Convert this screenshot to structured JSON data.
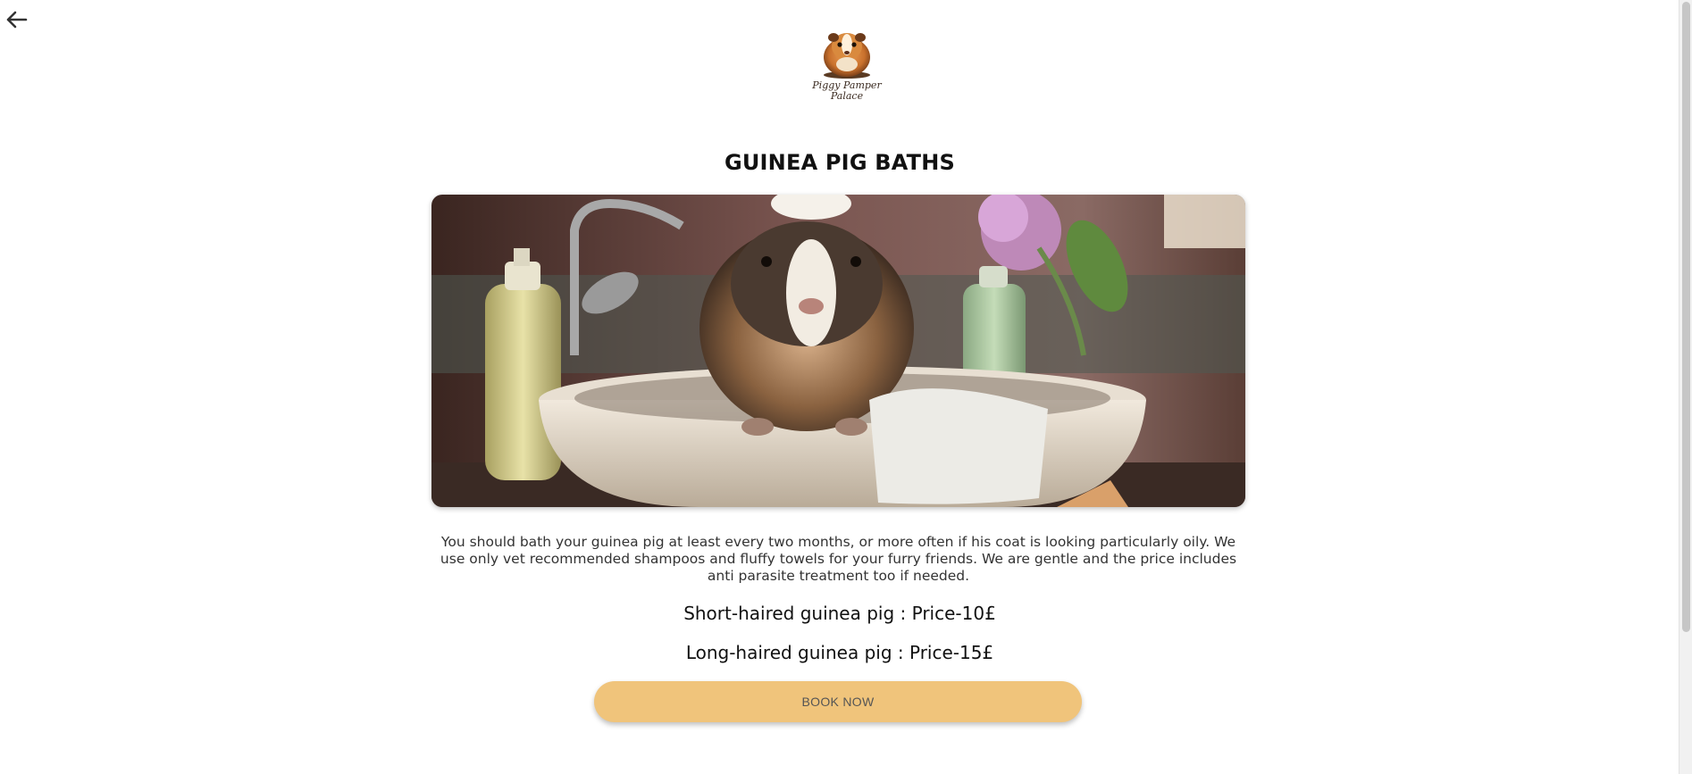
{
  "header": {
    "back_icon": "arrow-left-icon",
    "logo": {
      "name_line1": "Piggy Pamper",
      "name_line2": "Palace"
    }
  },
  "main": {
    "title": "GUINEA PIG BATHS",
    "hero_image": "guinea-pig-in-bathtub-photo",
    "description": "You should bath your guinea pig at least every two months, or more often if his coat is looking particularly oily. We use only vet recommended shampoos and fluffy towels for your furry friends. We are gentle and the price includes anti parasite treatment too if needed.",
    "prices": [
      {
        "label": "Short-haired guinea pig : Price-10£"
      },
      {
        "label": "Long-haired guinea pig : Price-15£"
      }
    ],
    "book_button": "BOOK NOW"
  },
  "colors": {
    "accent": "#f0c47b",
    "text": "#111111",
    "background": "#ffffff"
  }
}
